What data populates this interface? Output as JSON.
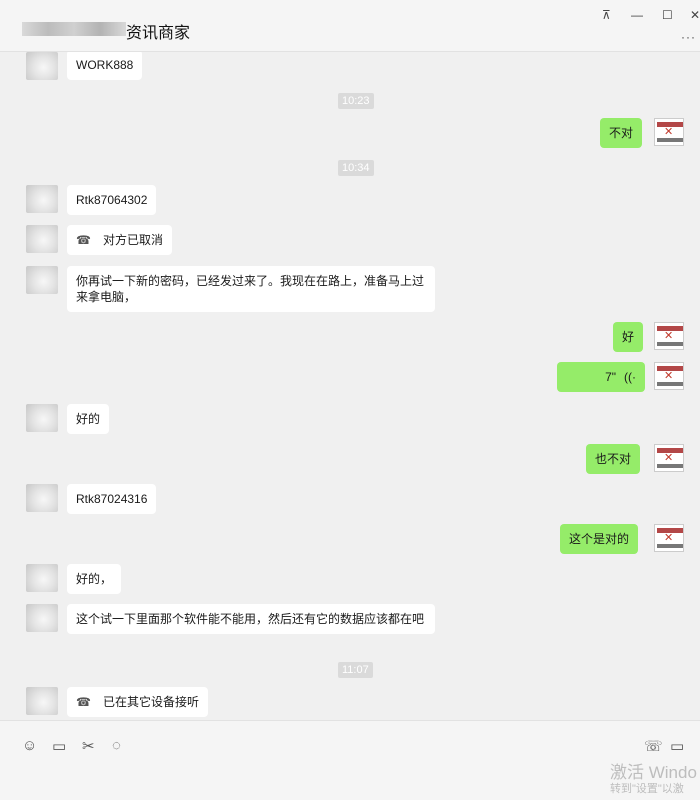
{
  "window": {
    "title": "资讯商家",
    "pin_icon": "pin-icon",
    "minimize_icon": "minimize-icon",
    "maximize_icon": "maximize-icon",
    "close_icon": "close-icon",
    "more_icon": "more-icon"
  },
  "messages": [
    {
      "type": "text",
      "side": "left",
      "text": "WORK888"
    },
    {
      "type": "time",
      "text": "10:23"
    },
    {
      "type": "text",
      "side": "right",
      "text": "不对"
    },
    {
      "type": "time",
      "text": "10:34"
    },
    {
      "type": "text",
      "side": "left",
      "text": "Rtk87064302"
    },
    {
      "type": "call",
      "side": "left",
      "text": "对方已取消"
    },
    {
      "type": "text",
      "side": "left",
      "text": "你再试一下新的密码，已经发过来了。我现在在路上，准备马上过来拿电脑，"
    },
    {
      "type": "text",
      "side": "right",
      "text": "好"
    },
    {
      "type": "voice",
      "side": "right",
      "text": "7\""
    },
    {
      "type": "text",
      "side": "left",
      "text": "好的"
    },
    {
      "type": "text",
      "side": "right",
      "text": "也不对"
    },
    {
      "type": "text",
      "side": "left",
      "text": "Rtk87024316"
    },
    {
      "type": "text",
      "side": "right",
      "text": "这个是对的"
    },
    {
      "type": "text",
      "side": "left",
      "text": "好的，"
    },
    {
      "type": "text",
      "side": "left",
      "text": "这个试一下里面那个软件能不能用，然后还有它的数据应该都在吧"
    },
    {
      "type": "time",
      "text": "11:07"
    },
    {
      "type": "call",
      "side": "left",
      "text": "已在其它设备接听"
    }
  ],
  "toolbar": {
    "icons": [
      "emoji-icon",
      "folder-icon",
      "scissors-icon",
      "chat-history-icon",
      "voice-call-icon",
      "video-call-icon"
    ]
  },
  "watermark": {
    "line1": "激活 Windo",
    "line2": "转到\"设置\"以激"
  },
  "colors": {
    "outgoing_bubble": "#95ec69",
    "incoming_bubble": "#ffffff",
    "background": "#f0f0f0"
  }
}
